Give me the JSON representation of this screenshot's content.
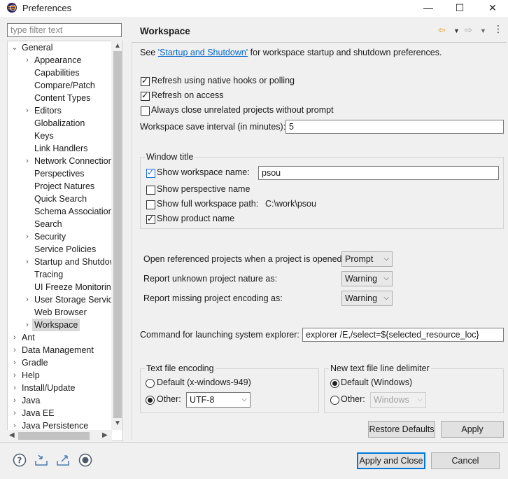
{
  "window": {
    "title": "Preferences",
    "minimize_glyph": "—",
    "maximize_glyph": "☐",
    "close_glyph": "✕"
  },
  "filter": {
    "placeholder": "type filter text",
    "value": ""
  },
  "tree": {
    "expand_glyph": "›",
    "collapse_glyph": "⌄",
    "general": "General",
    "general_children": [
      {
        "label": "Appearance",
        "expandable": true
      },
      {
        "label": "Capabilities",
        "expandable": false
      },
      {
        "label": "Compare/Patch",
        "expandable": false
      },
      {
        "label": "Content Types",
        "expandable": false
      },
      {
        "label": "Editors",
        "expandable": true
      },
      {
        "label": "Globalization",
        "expandable": false
      },
      {
        "label": "Keys",
        "expandable": false
      },
      {
        "label": "Link Handlers",
        "expandable": false
      },
      {
        "label": "Network Connection",
        "expandable": true
      },
      {
        "label": "Perspectives",
        "expandable": false
      },
      {
        "label": "Project Natures",
        "expandable": false
      },
      {
        "label": "Quick Search",
        "expandable": false
      },
      {
        "label": "Schema Associations",
        "expandable": false
      },
      {
        "label": "Search",
        "expandable": false
      },
      {
        "label": "Security",
        "expandable": true
      },
      {
        "label": "Service Policies",
        "expandable": false
      },
      {
        "label": "Startup and Shutdow",
        "expandable": true
      },
      {
        "label": "Tracing",
        "expandable": false
      },
      {
        "label": "UI Freeze Monitoring",
        "expandable": false
      },
      {
        "label": "User Storage Service",
        "expandable": true
      },
      {
        "label": "Web Browser",
        "expandable": false
      },
      {
        "label": "Workspace",
        "expandable": true,
        "selected": true
      }
    ],
    "top_level": [
      "Ant",
      "Data Management",
      "Gradle",
      "Help",
      "Install/Update",
      "Java",
      "Java EE",
      "Java Persistence"
    ]
  },
  "page": {
    "title": "Workspace",
    "intro_prefix": "See ",
    "intro_link": "'Startup and Shutdown'",
    "intro_suffix": " for workspace startup and shutdown preferences.",
    "refresh_native": {
      "label": "Refresh using native hooks or polling",
      "checked": true
    },
    "refresh_access": {
      "label": "Refresh on access",
      "checked": true
    },
    "always_close": {
      "label": "Always close unrelated projects without prompt",
      "checked": false
    },
    "save_interval": {
      "label": "Workspace save interval (in minutes):",
      "value": "5"
    },
    "window_title": {
      "group_label": "Window title",
      "show_workspace_name": {
        "label": "Show workspace name:",
        "checked": true,
        "value": "psou"
      },
      "show_perspective_name": {
        "label": "Show perspective name",
        "checked": false
      },
      "show_full_path": {
        "label": "Show full workspace path:",
        "checked": false,
        "path": "C:\\work\\psou"
      },
      "show_product_name": {
        "label": "Show product name",
        "checked": true
      }
    },
    "open_referenced": {
      "label": "Open referenced projects when a project is opened:",
      "value": "Prompt"
    },
    "unknown_nature": {
      "label": "Report unknown project nature as:",
      "value": "Warning"
    },
    "missing_encoding": {
      "label": "Report missing project encoding as:",
      "value": "Warning"
    },
    "explorer_command": {
      "label": "Command for launching system explorer:",
      "value": "explorer /E,/select=${selected_resource_loc}"
    },
    "text_encoding": {
      "group_label": "Text file encoding",
      "default_label": "Default (x-windows-949)",
      "other_label": "Other:",
      "other_value": "UTF-8",
      "selected": "other"
    },
    "line_delimiter": {
      "group_label": "New text file line delimiter",
      "default_label": "Default (Windows)",
      "other_label": "Other:",
      "other_value": "Windows",
      "selected": "default"
    },
    "restore_defaults": "Restore Defaults",
    "apply": "Apply"
  },
  "footer": {
    "apply_and_close": "Apply and Close",
    "cancel": "Cancel"
  }
}
